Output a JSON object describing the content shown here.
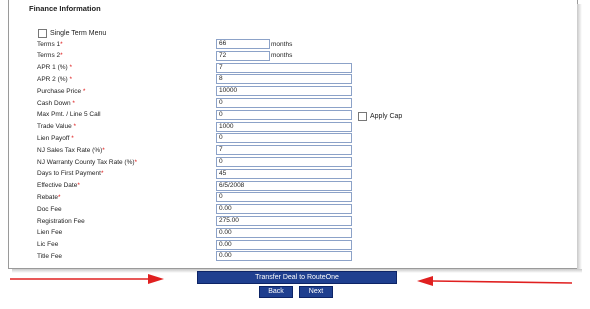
{
  "section": {
    "title": "Finance Information",
    "single_term_label": "Single Term Menu"
  },
  "fields": [
    {
      "label": "Terms 1",
      "req": "*",
      "value": "66",
      "suffix": "months"
    },
    {
      "label": "Terms 2",
      "req": "*",
      "value": "72",
      "suffix": "months"
    },
    {
      "label": "APR 1 (%) ",
      "req": "*",
      "value": "7",
      "suffix": ""
    },
    {
      "label": "APR 2 (%) ",
      "req": "*",
      "value": "8",
      "suffix": ""
    },
    {
      "label": "Purchase Price ",
      "req": "*",
      "value": "10000",
      "suffix": ""
    },
    {
      "label": "Cash Down ",
      "req": "*",
      "value": "0",
      "suffix": ""
    },
    {
      "label": "Max Pmt. / Line 5 Call",
      "req": "",
      "value": "0",
      "suffix": ""
    },
    {
      "label": "Trade Value ",
      "req": "*",
      "value": "1000",
      "suffix": ""
    },
    {
      "label": "Lien Payoff ",
      "req": "*",
      "value": "0",
      "suffix": ""
    },
    {
      "label": "NJ Sales Tax Rate (%)",
      "req": "*",
      "value": "7",
      "suffix": ""
    },
    {
      "label": "NJ Warranty County Tax Rate (%)",
      "req": "*",
      "value": "0",
      "suffix": ""
    },
    {
      "label": "Days to First Payment",
      "req": "*",
      "value": "45",
      "suffix": ""
    },
    {
      "label": "Effective Date",
      "req": "*",
      "value": "6/5/2008",
      "suffix": ""
    },
    {
      "label": "Rebate",
      "req": "*",
      "value": "0",
      "suffix": ""
    },
    {
      "label": "Doc Fee",
      "req": "",
      "value": "0.00",
      "suffix": ""
    },
    {
      "label": "Registration Fee",
      "req": "",
      "value": "275.00",
      "suffix": ""
    },
    {
      "label": "Lien Fee",
      "req": "",
      "value": "0.00",
      "suffix": ""
    },
    {
      "label": "Lic Fee",
      "req": "",
      "value": "0.00",
      "suffix": ""
    },
    {
      "label": "Title Fee",
      "req": "",
      "value": "0.00",
      "suffix": ""
    }
  ],
  "apply_cap_label": "Apply Cap",
  "buttons": {
    "transfer": "Transfer Deal to RouteOne",
    "back": "Back",
    "next": "Next"
  },
  "colors": {
    "button_bg": "#1f3f8f",
    "arrow": "#e02020",
    "required": "#d11111"
  }
}
